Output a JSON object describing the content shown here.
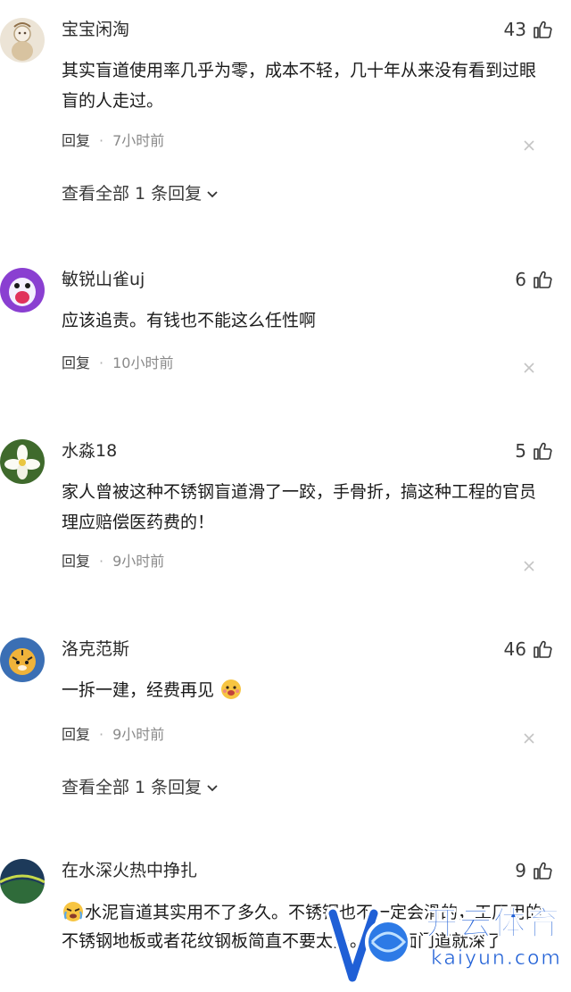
{
  "comments": [
    {
      "username": "宝宝闲淘",
      "likes": "43",
      "text": "其实盲道使用率几乎为零，成本不轻，几十年从来没有看到过眼盲的人走过。",
      "reply_label": "回复",
      "time": "7小时前",
      "expand_label": "查看全部 1 条回复"
    },
    {
      "username": "敏锐山雀uj",
      "likes": "6",
      "text": "应该追责。有钱也不能这么任性啊",
      "reply_label": "回复",
      "time": "10小时前"
    },
    {
      "username": "水淼18",
      "likes": "5",
      "text": "家人曾被这种不锈钢盲道滑了一跤，手骨折，搞这种工程的官员理应赔偿医药费的！",
      "reply_label": "回复",
      "time": "9小时前"
    },
    {
      "username": "洛克范斯",
      "likes": "46",
      "text": "一拆一建，经费再见",
      "reply_label": "回复",
      "time": "9小时前",
      "expand_label": "查看全部 1 条回复"
    },
    {
      "username": "在水深火热中挣扎",
      "likes": "9",
      "text": "水泥盲道其实用不了多久。不锈钢也不一定会滑的，工厂用的不锈钢地板或者花纹钢板简直不要太多。这里面门道就深了"
    }
  ],
  "watermark": {
    "brand": "开云体育",
    "domain": "kaiyun.com"
  },
  "colors": {
    "text": "#1a1a1a",
    "meta": "#8a8a8a",
    "watermark_blue": "#1f5fd6"
  }
}
